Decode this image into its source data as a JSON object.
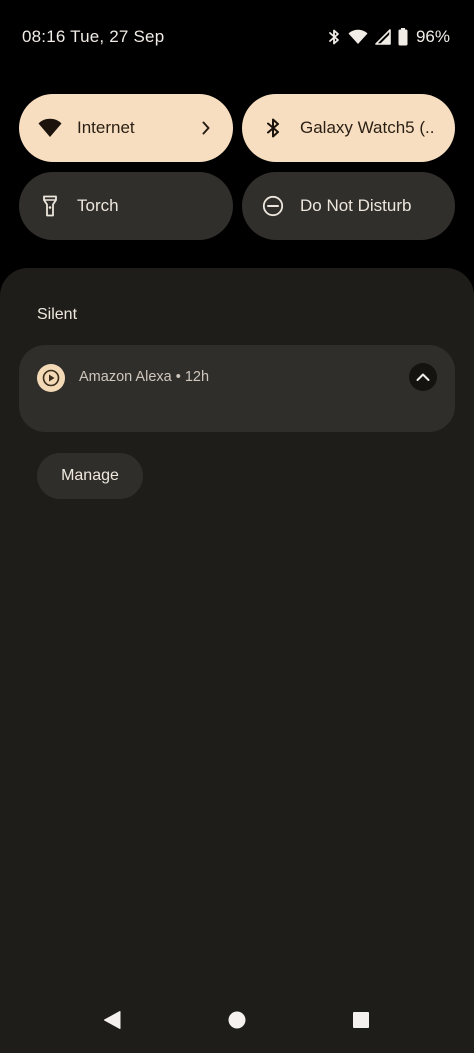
{
  "status_bar": {
    "time_date": "08:16 Tue, 27 Sep",
    "icons": [
      "bluetooth-icon",
      "wifi-icon",
      "signal-icon",
      "battery-icon"
    ],
    "battery_percent": "96%"
  },
  "quick_settings": {
    "tiles": [
      {
        "label": "Internet",
        "icon": "wifi-icon",
        "state": "active",
        "has_chevron": true
      },
      {
        "label": "Galaxy Watch5 (..",
        "icon": "bluetooth-icon",
        "state": "active",
        "has_chevron": false
      },
      {
        "label": "Torch",
        "icon": "flashlight-icon",
        "state": "inactive",
        "has_chevron": false
      },
      {
        "label": "Do Not Disturb",
        "icon": "do-not-disturb-icon",
        "state": "inactive",
        "has_chevron": false
      }
    ]
  },
  "notifications": {
    "section_title": "Silent",
    "items": [
      {
        "app": "Amazon Alexa",
        "time": "12h",
        "title_line": "Amazon Alexa • 12h",
        "icon": "play-circle-icon"
      }
    ],
    "manage_label": "Manage"
  },
  "nav_bar": {
    "buttons": [
      "back-icon",
      "home-icon",
      "recents-icon"
    ]
  },
  "colors": {
    "background": "#000000",
    "tile_active": "#f7dec0",
    "tile_inactive": "#312f2b",
    "shade": "#1f1d19",
    "card": "#302e2a"
  }
}
